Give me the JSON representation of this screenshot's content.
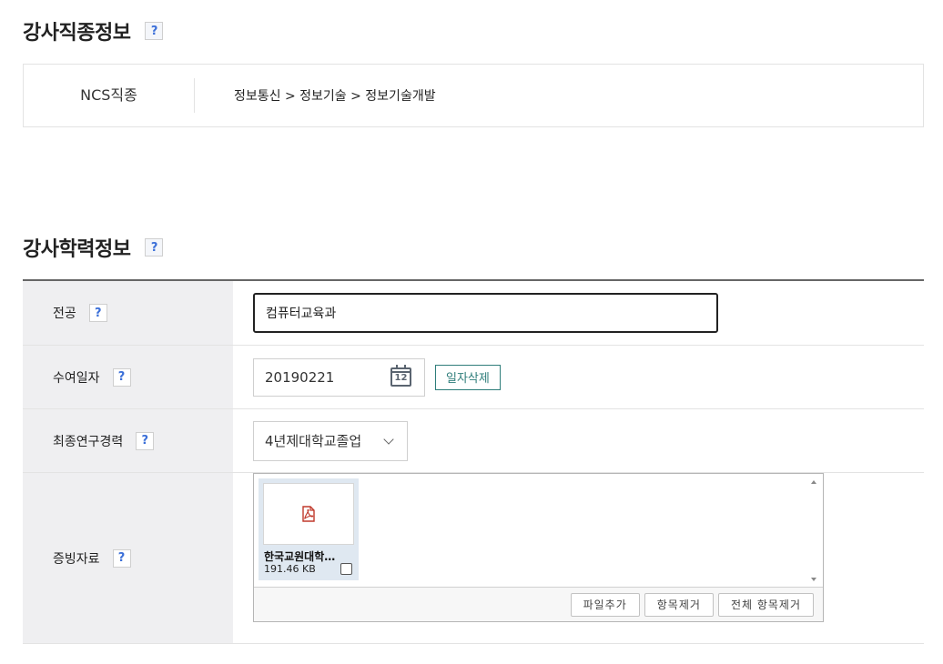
{
  "instructor_job": {
    "title": "강사직종정보",
    "help": "?",
    "ncs_label": "NCS직종",
    "ncs_value": "정보통신 > 정보기술 > 정보기술개발"
  },
  "instructor_edu": {
    "title": "강사학력정보",
    "help": "?",
    "major": {
      "label": "전공",
      "help": "?",
      "value": "컴퓨터교육과"
    },
    "degree_date": {
      "label": "수여일자",
      "help": "?",
      "value": "20190221",
      "calendar_day": "12",
      "delete_label": "일자삭제"
    },
    "final_research": {
      "label": "최종연구경력",
      "help": "?",
      "selected": "4년제대학교졸업"
    },
    "evidence": {
      "label": "증빙자료",
      "help": "?",
      "files": [
        {
          "name": "한국교원대학…",
          "size": "191.46 KB",
          "icon": "pdf-icon"
        }
      ],
      "add_label": "파일추가",
      "remove_label": "항목제거",
      "remove_all_label": "전체 항목제거"
    }
  },
  "colors": {
    "accent_teal": "#2e7d7a",
    "help_blue": "#3b6fd8",
    "label_bg": "#efeff1",
    "pdf_red": "#c0392b"
  }
}
